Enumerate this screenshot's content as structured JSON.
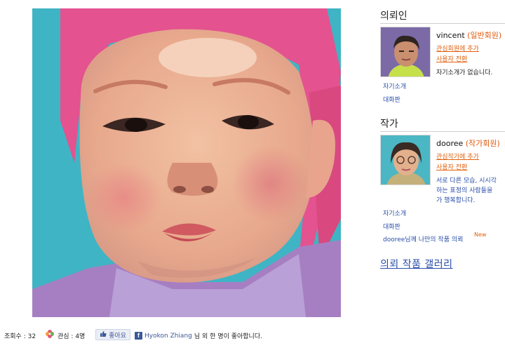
{
  "sidebar": {
    "requester": {
      "title": "의뢰인",
      "name": "vincent",
      "role": "(일반회원)",
      "follow_link": "관심회원에 추가",
      "switch_link": "사용자 전환",
      "intro": "자기소개가 없습니다.",
      "links": [
        "자기소개",
        "대화판"
      ]
    },
    "artist": {
      "title": "작가",
      "name": "dooree",
      "role": "(작가회원)",
      "follow_link": "관심작가에 추가",
      "switch_link": "사용자 전환",
      "intro_lines": [
        "서로 다른 모습, 시시각",
        "하는 표정의 사람들을 ",
        "가 행복합니다."
      ],
      "links": [
        "자기소개",
        "대화판",
        "dooree님께 나만의 작품 의뢰"
      ],
      "new_badge": "New"
    },
    "gallery_link": "의뢰 작품 갤러리"
  },
  "footer": {
    "views": "조회수 : 32",
    "interest": "관심 : 4명",
    "like_button": "좋아요",
    "fb_name": "Hyokon Zhiang",
    "fb_text": "님 외 한 명이 좋아합니다.",
    "fb_icon": "f"
  },
  "icons": {
    "interest": "flower-icon",
    "like": "thumbs-up-icon",
    "facebook": "facebook-icon"
  }
}
